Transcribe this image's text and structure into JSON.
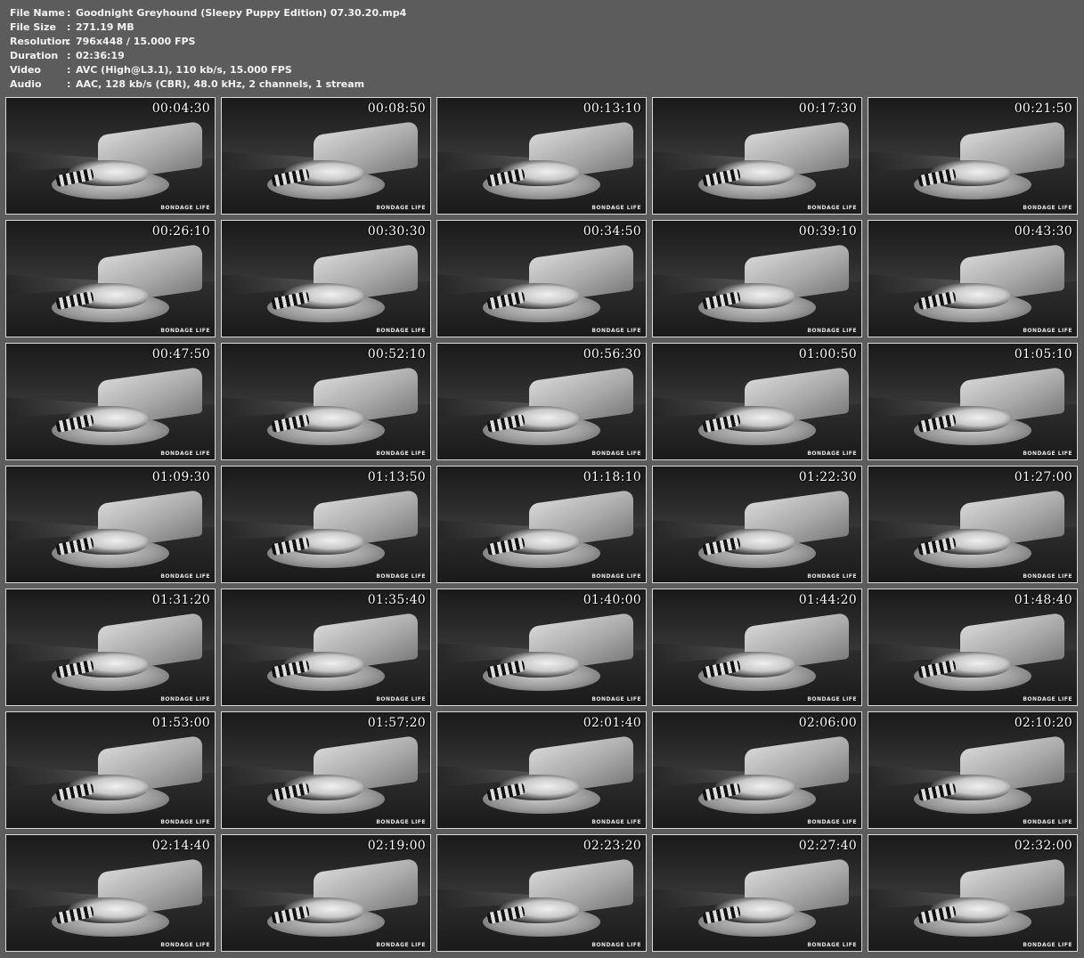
{
  "info": [
    {
      "label": "File Name",
      "value": "Goodnight Greyhound (Sleepy Puppy Edition) 07.30.20.mp4"
    },
    {
      "label": "File Size",
      "value": "271.19 MB"
    },
    {
      "label": "Resolution",
      "value": "796x448 / 15.000 FPS"
    },
    {
      "label": "Duration",
      "value": "02:36:19"
    },
    {
      "label": "Video",
      "value": "AVC (High@L3.1), 110 kb/s, 15.000 FPS"
    },
    {
      "label": "Audio",
      "value": "AAC, 128 kb/s (CBR), 48.0 kHz, 2 channels, 1 stream"
    }
  ],
  "separator": ":",
  "watermark": "BONDAGE LIFE",
  "thumbnails": [
    "00:04:30",
    "00:08:50",
    "00:13:10",
    "00:17:30",
    "00:21:50",
    "00:26:10",
    "00:30:30",
    "00:34:50",
    "00:39:10",
    "00:43:30",
    "00:47:50",
    "00:52:10",
    "00:56:30",
    "01:00:50",
    "01:05:10",
    "01:09:30",
    "01:13:50",
    "01:18:10",
    "01:22:30",
    "01:27:00",
    "01:31:20",
    "01:35:40",
    "01:40:00",
    "01:44:20",
    "01:48:40",
    "01:53:00",
    "01:57:20",
    "02:01:40",
    "02:06:00",
    "02:10:20",
    "02:14:40",
    "02:19:00",
    "02:23:20",
    "02:27:40",
    "02:32:00"
  ]
}
